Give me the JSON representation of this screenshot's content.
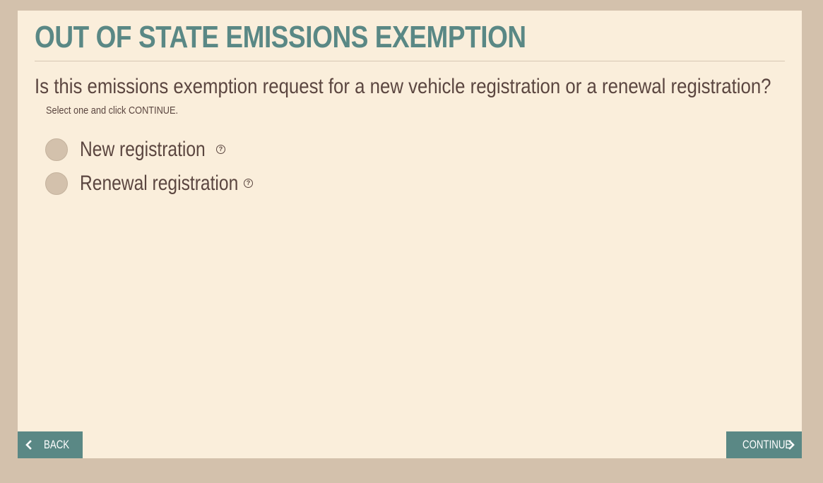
{
  "header": {
    "title": "OUT OF STATE EMISSIONS EXEMPTION"
  },
  "main": {
    "question": "Is this emissions exemption request for a new vehicle registration or a renewal registration?",
    "instruction": "Select one and click CONTINUE.",
    "options": [
      {
        "label": "New registration",
        "help_icon": "question-circle-icon",
        "selected": false
      },
      {
        "label": "Renewal registration",
        "help_icon": "question-circle-icon",
        "selected": false
      }
    ],
    "help_glyph": "?"
  },
  "footer": {
    "back_label": "BACK",
    "continue_label": "CONTINUE",
    "back_icon": "chevron-left-icon",
    "continue_icon": "chevron-right-icon"
  },
  "colors": {
    "page_background": "#d3c1ac",
    "panel_background": "#faeedb",
    "accent": "#5a8885",
    "text": "#5b4640",
    "radio_fill": "#d3c1ac"
  }
}
